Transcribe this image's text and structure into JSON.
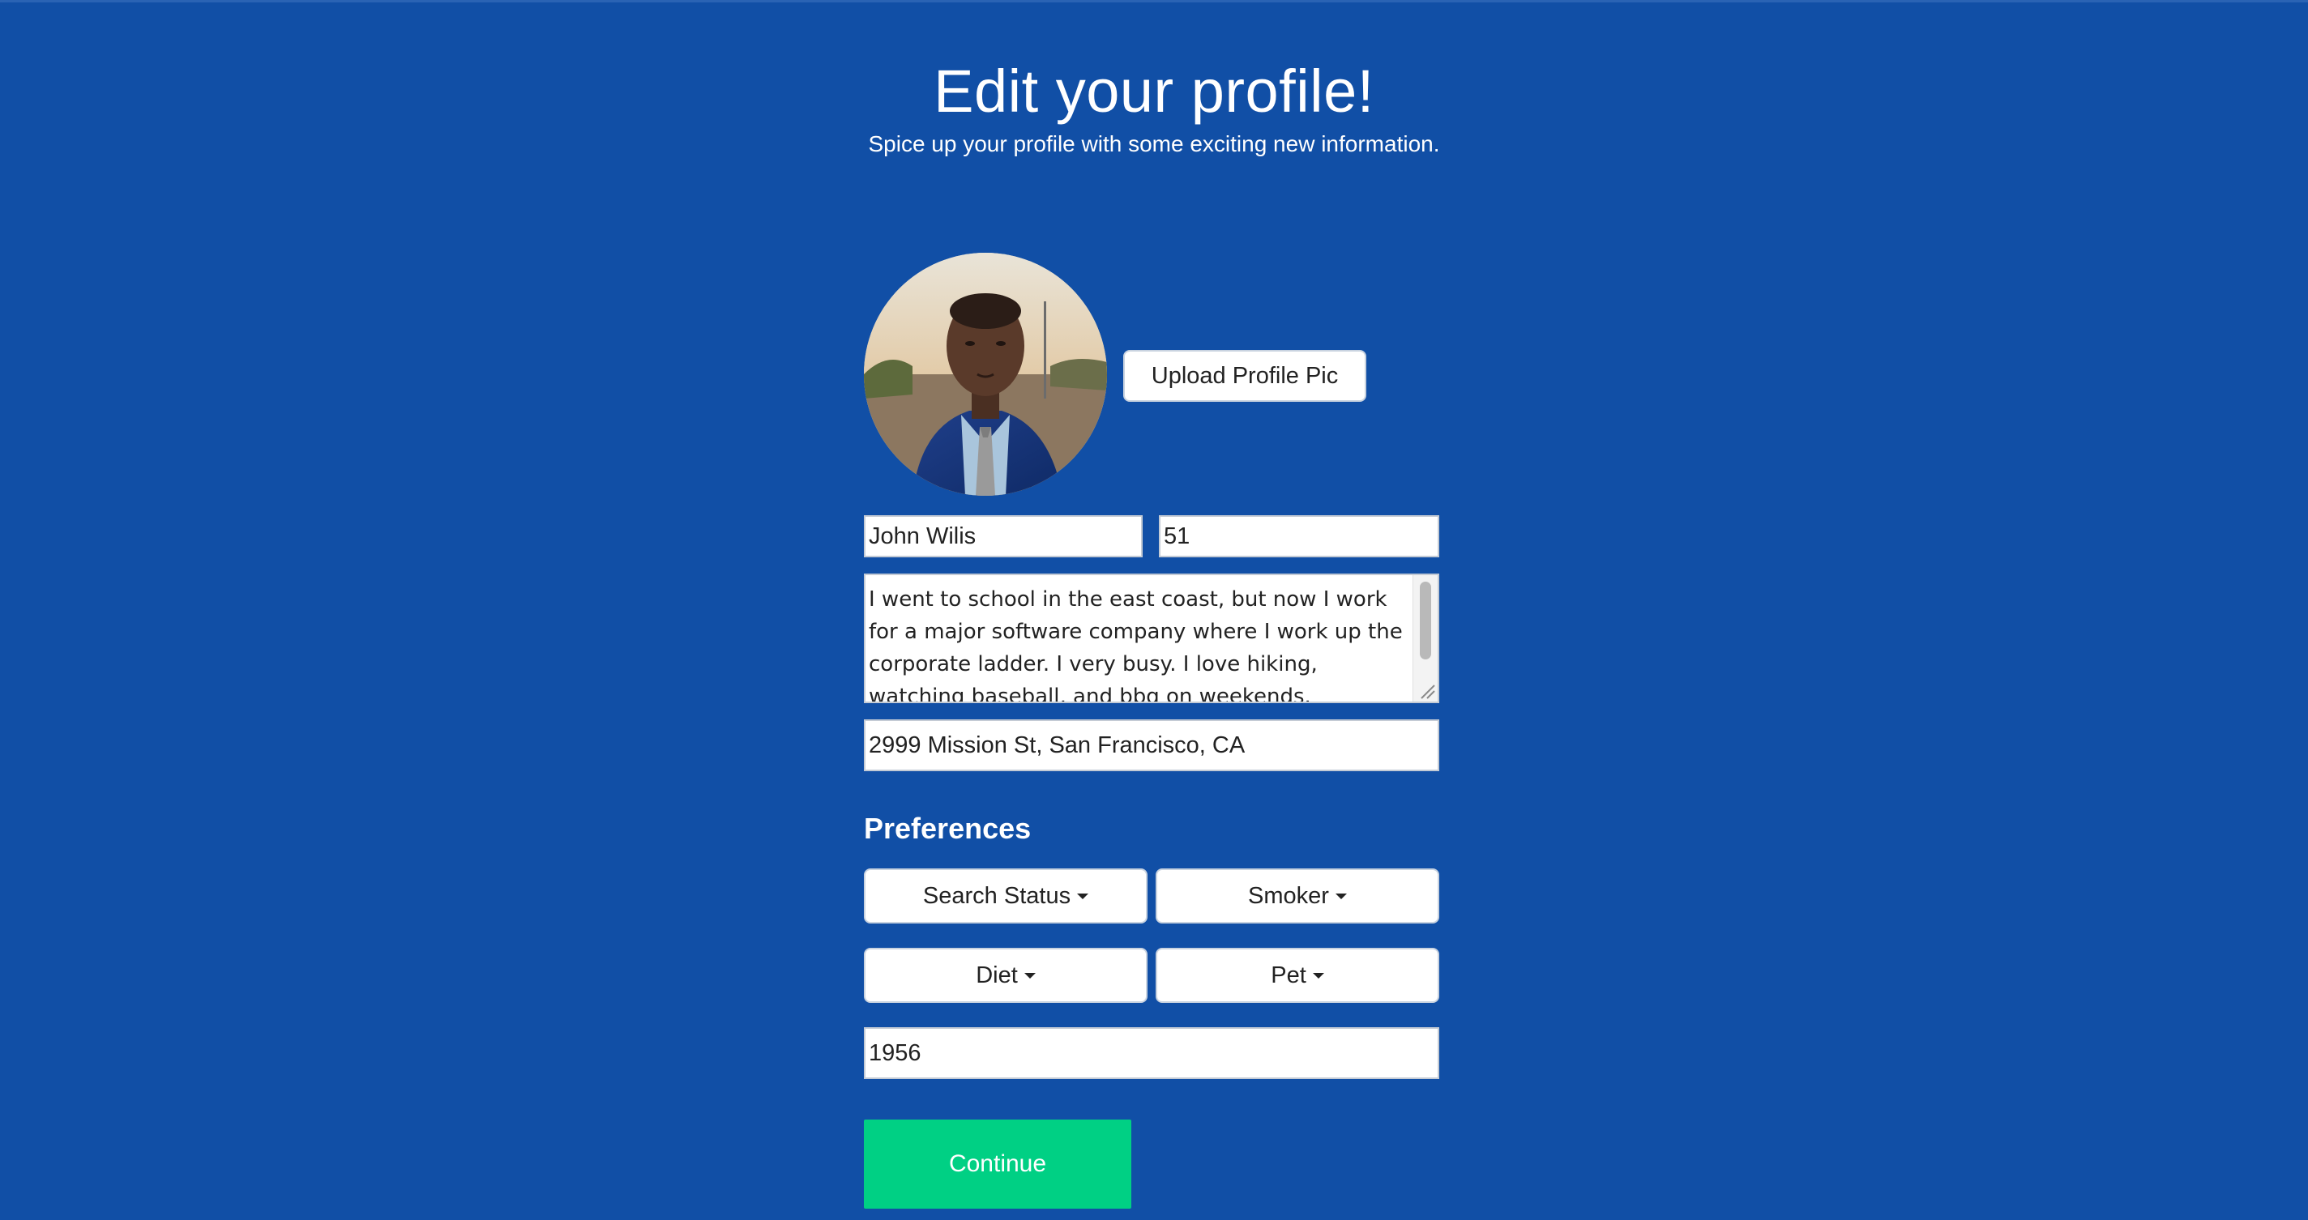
{
  "header": {
    "title": "Edit your profile!",
    "subtitle": "Spice up your profile with some exciting new information."
  },
  "profile": {
    "upload_label": "Upload Profile Pic",
    "name_value": "John Wilis",
    "age_value": "51",
    "bio_value": "I went to school in the east coast, but now I work for a major software company where I work up the corporate ladder. I very busy. I love hiking, watching baseball, and bbq on weekends.",
    "address_value": "2999 Mission St, San Francisco, CA"
  },
  "preferences": {
    "title": "Preferences",
    "dropdowns": [
      {
        "label": "Search Status"
      },
      {
        "label": "Smoker"
      },
      {
        "label": "Diet"
      },
      {
        "label": "Pet"
      }
    ],
    "year_value": "1956"
  },
  "actions": {
    "continue_label": "Continue"
  },
  "colors": {
    "background": "#114fa6",
    "continue": "#00d084",
    "button_bg": "#ffffff"
  }
}
